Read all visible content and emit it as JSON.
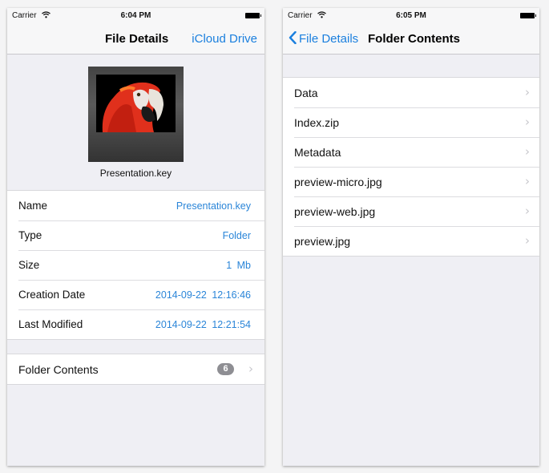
{
  "left": {
    "status": {
      "carrier": "Carrier",
      "time": "6:04 PM",
      "wifi_icon": "wifi-icon",
      "battery_icon": "battery-icon"
    },
    "nav": {
      "title": "File Details",
      "right_button": "iCloud Drive"
    },
    "preview": {
      "caption": "Presentation.key",
      "image": "parrot-photo"
    },
    "details": [
      {
        "label": "Name",
        "value": "Presentation.key"
      },
      {
        "label": "Type",
        "value": "Folder"
      },
      {
        "label": "Size",
        "value": "1 Mb"
      },
      {
        "label": "Creation Date",
        "value": "2014-09-22  12:16:46"
      },
      {
        "label": "Last Modified",
        "value": "2014-09-22  12:21:54"
      }
    ],
    "folder_contents": {
      "label": "Folder Contents",
      "count": "6",
      "chevron_icon": "chevron-right-icon"
    }
  },
  "right": {
    "status": {
      "carrier": "Carrier",
      "time": "6:05 PM",
      "wifi_icon": "wifi-icon",
      "battery_icon": "battery-icon"
    },
    "nav": {
      "back_label": "File Details",
      "back_icon": "chevron-left-icon",
      "title": "Folder Contents"
    },
    "items": [
      {
        "name": "Data"
      },
      {
        "name": "Index.zip"
      },
      {
        "name": "Metadata"
      },
      {
        "name": "preview-micro.jpg"
      },
      {
        "name": "preview-web.jpg"
      },
      {
        "name": "preview.jpg"
      }
    ]
  },
  "colors": {
    "accent": "#1a7fde",
    "background": "#efeff4",
    "badge": "#8e8e93"
  }
}
